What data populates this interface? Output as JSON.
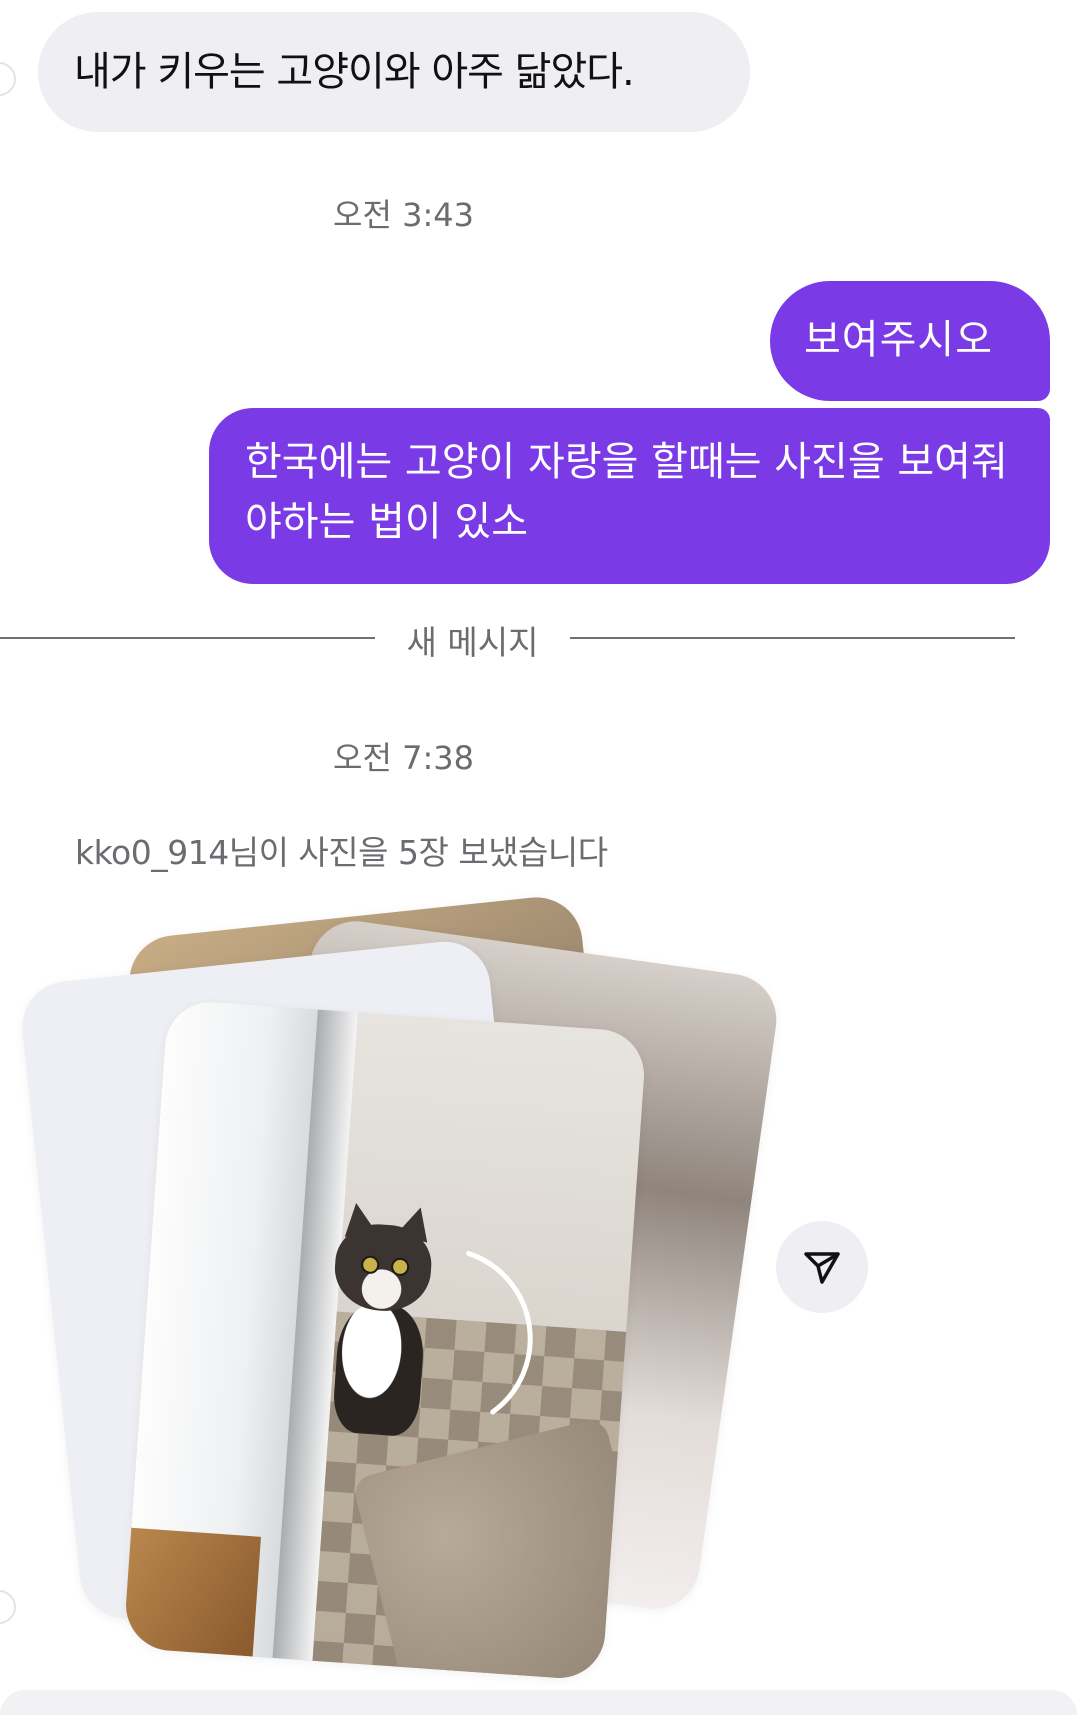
{
  "messages": {
    "incoming_1": "내가 키우는 고양이와 아주 닮았다.",
    "time_1": "오전 3:43",
    "outgoing_1": "보여주시오",
    "outgoing_2": "한국에는 고양이 자랑을 할때는 사진을 보여줘야하는 법이 있소",
    "new_messages_divider": "새 메시지",
    "time_2": "오전 7:38",
    "photo_caption": "kko0_914님이 사진을 5장 보냈습니다"
  },
  "photo_stack": {
    "count": 5,
    "upload_progress": 0.35
  },
  "icons": {
    "share": "send-icon"
  },
  "colors": {
    "outgoing_bubble": "#7a3ae6",
    "incoming_bubble": "#efeff3",
    "meta_text": "#6b6b70"
  }
}
